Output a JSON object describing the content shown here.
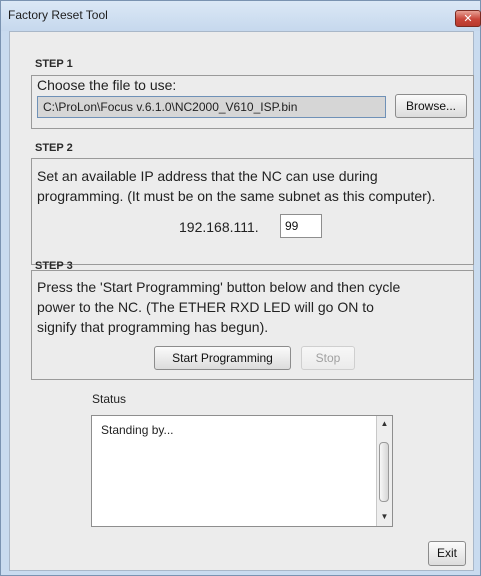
{
  "window": {
    "title": "Factory Reset Tool",
    "close_icon": "close-icon"
  },
  "step1": {
    "label": "STEP 1",
    "instruction": "Choose the file to use:",
    "file_path": "C:\\ProLon\\Focus v.6.1.0\\NC2000_V610_ISP.bin",
    "browse_label": "Browse..."
  },
  "step2": {
    "label": "STEP 2",
    "line1": "Set an available IP address that the NC can use during",
    "line2": "programming. (It must be on the same subnet as this computer).",
    "ip_prefix": "192.168.111.",
    "ip_last": "99"
  },
  "step3": {
    "label": "STEP 3",
    "line1": "Press the 'Start Programming' button below and then cycle",
    "line2": "power to the NC. (The ETHER RXD LED will go ON to",
    "line3": "signify that programming has begun).",
    "start_label": "Start Programming",
    "stop_label": "Stop"
  },
  "status": {
    "label": "Status",
    "text": "Standing by..."
  },
  "exit_label": "Exit"
}
